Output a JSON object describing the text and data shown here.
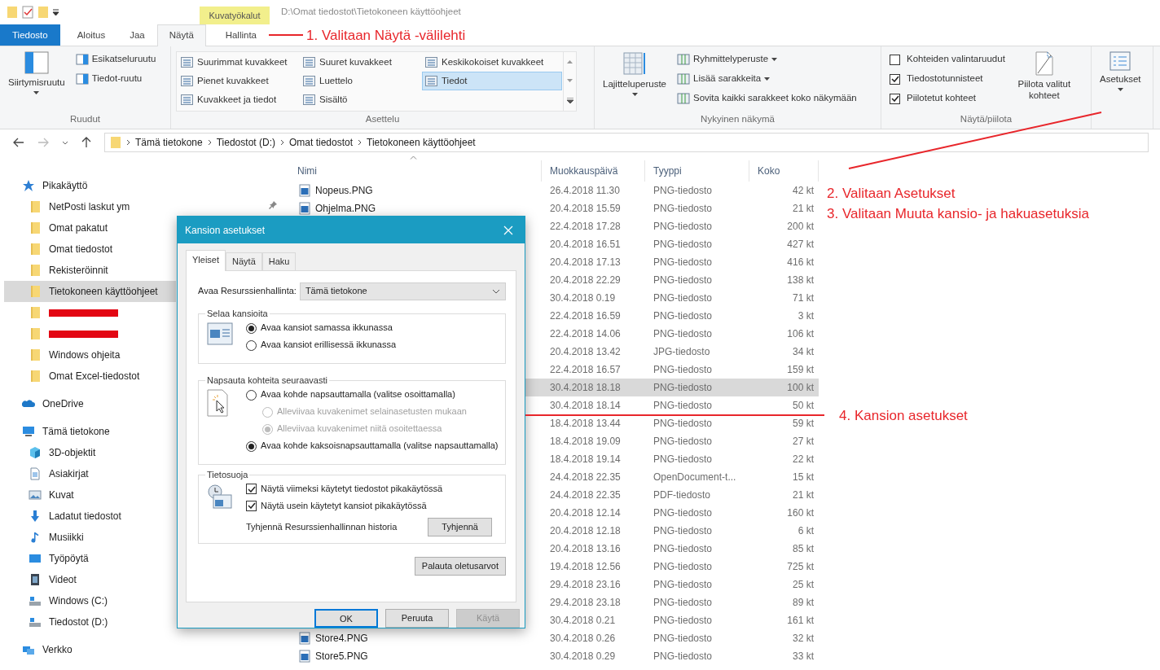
{
  "title_bar": {
    "context_tab": "Kuvatyökalut",
    "path": "D:\\Omat tiedostot\\Tietokoneen käyttöohjeet"
  },
  "ribbon_tabs": [
    {
      "label": "Tiedosto",
      "kind": "file",
      "selected": false
    },
    {
      "label": "Aloitus",
      "kind": "tab",
      "selected": false
    },
    {
      "label": "Jaa",
      "kind": "tab",
      "selected": false
    },
    {
      "label": "Näytä",
      "kind": "tab",
      "selected": true
    },
    {
      "label": "Hallinta",
      "kind": "context",
      "selected": false
    }
  ],
  "ribbon": {
    "panes": {
      "label": "Ruudut",
      "button": "Siirtymisruutu",
      "items": [
        "Esikatseluruutu",
        "Tiedot-ruutu"
      ]
    },
    "layout": {
      "label": "Asettelu",
      "options": [
        {
          "label": "Suurimmat kuvakkeet",
          "selected": false
        },
        {
          "label": "Pienet kuvakkeet",
          "selected": false
        },
        {
          "label": "Kuvakkeet ja tiedot",
          "selected": false
        },
        {
          "label": "Suuret kuvakkeet",
          "selected": false
        },
        {
          "label": "Luettelo",
          "selected": false
        },
        {
          "label": "Sisältö",
          "selected": false
        },
        {
          "label": "Keskikokoiset kuvakkeet",
          "selected": false
        },
        {
          "label": "Tiedot",
          "selected": true
        }
      ]
    },
    "current_view": {
      "label": "Nykyinen näkymä",
      "button": "Lajitteluperuste",
      "items": [
        {
          "label": "Ryhmittelyperuste",
          "dropdown": true
        },
        {
          "label": "Lisää sarakkeita",
          "dropdown": true
        },
        {
          "label": "Sovita kaikki sarakkeet koko näkymään",
          "dropdown": false
        }
      ]
    },
    "show_hide": {
      "label": "Näytä/piilota",
      "checkboxes": [
        {
          "label": "Kohteiden valintaruudut",
          "checked": false
        },
        {
          "label": "Tiedostotunnisteet",
          "checked": true
        },
        {
          "label": "Piilotetut kohteet",
          "checked": true
        }
      ],
      "button": "Piilota valitut kohteet"
    },
    "options": {
      "button": "Asetukset"
    }
  },
  "address": {
    "crumbs": [
      "Tämä tietokone",
      "Tiedostot (D:)",
      "Omat tiedostot",
      "Tietokoneen käyttöohjeet"
    ]
  },
  "navigation": [
    {
      "label": "Pikakäyttö",
      "kind": "star",
      "selected": false,
      "children": [
        {
          "label": "NetPosti laskut ym",
          "kind": "folder",
          "pinned": true,
          "selected": false
        },
        {
          "label": "Omat pakatut",
          "kind": "folder",
          "pinned": false,
          "selected": false
        },
        {
          "label": "Omat tiedostot",
          "kind": "folder",
          "pinned": false,
          "selected": false
        },
        {
          "label": "Rekisteröinnit",
          "kind": "folder",
          "pinned": false,
          "selected": false
        },
        {
          "label": "Tietokoneen käyttöohjeet",
          "kind": "folder",
          "pinned": false,
          "selected": true
        },
        {
          "kind": "redacted",
          "pinned": false,
          "selected": false
        },
        {
          "kind": "redacted",
          "pinned": false,
          "selected": false
        },
        {
          "label": "Windows ohjeita",
          "kind": "folder",
          "pinned": false,
          "selected": false
        },
        {
          "label": "Omat Excel-tiedostot",
          "kind": "folder",
          "pinned": false,
          "selected": false
        }
      ]
    },
    {
      "label": "OneDrive",
      "kind": "cloud",
      "selected": false
    },
    {
      "label": "Tämä tietokone",
      "kind": "pc",
      "selected": false,
      "children": [
        {
          "label": "3D-objektit",
          "kind": "cube",
          "selected": false
        },
        {
          "label": "Asiakirjat",
          "kind": "document",
          "selected": false
        },
        {
          "label": "Kuvat",
          "kind": "pictures",
          "selected": false
        },
        {
          "label": "Ladatut tiedostot",
          "kind": "download",
          "selected": false
        },
        {
          "label": "Musiikki",
          "kind": "music",
          "selected": false
        },
        {
          "label": "Työpöytä",
          "kind": "desktop",
          "selected": false
        },
        {
          "label": "Videot",
          "kind": "video",
          "selected": false
        },
        {
          "label": "Windows (C:)",
          "kind": "drive",
          "selected": false
        },
        {
          "label": "Tiedostot (D:)",
          "kind": "drive",
          "selected": false
        }
      ]
    },
    {
      "label": "Verkko",
      "kind": "network",
      "selected": false
    }
  ],
  "file_list": {
    "columns": [
      {
        "label": "Nimi",
        "sorted": true
      },
      {
        "label": "Muokkauspäivä",
        "sorted": false
      },
      {
        "label": "Tyyppi",
        "sorted": false
      },
      {
        "label": "Koko",
        "sorted": false
      }
    ],
    "rows": [
      {
        "name": "Nopeus.PNG",
        "modified": "26.4.2018 11.30",
        "type": "PNG-tiedosto",
        "size": "42 kt",
        "selected": false
      },
      {
        "name": "Ohjelma.PNG",
        "modified": "20.4.2018 15.59",
        "type": "PNG-tiedosto",
        "size": "21 kt",
        "selected": false
      },
      {
        "modified": "22.4.2018 17.28",
        "type": "PNG-tiedosto",
        "size": "200 kt",
        "selected": false
      },
      {
        "modified": "20.4.2018 16.51",
        "type": "PNG-tiedosto",
        "size": "427 kt",
        "selected": false
      },
      {
        "modified": "20.4.2018 17.13",
        "type": "PNG-tiedosto",
        "size": "416 kt",
        "selected": false
      },
      {
        "modified": "20.4.2018 22.29",
        "type": "PNG-tiedosto",
        "size": "138 kt",
        "selected": false
      },
      {
        "modified": "30.4.2018 0.19",
        "type": "PNG-tiedosto",
        "size": "71 kt",
        "selected": false
      },
      {
        "modified": "22.4.2018 16.59",
        "type": "PNG-tiedosto",
        "size": "3 kt",
        "selected": false
      },
      {
        "modified": "22.4.2018 14.06",
        "type": "PNG-tiedosto",
        "size": "106 kt",
        "selected": false
      },
      {
        "modified": "20.4.2018 13.42",
        "type": "JPG-tiedosto",
        "size": "34 kt",
        "selected": false
      },
      {
        "modified": "22.4.2018 16.57",
        "type": "PNG-tiedosto",
        "size": "159 kt",
        "selected": false
      },
      {
        "modified": "30.4.2018 18.18",
        "type": "PNG-tiedosto",
        "size": "100 kt",
        "selected": true
      },
      {
        "modified": "30.4.2018 18.14",
        "type": "PNG-tiedosto",
        "size": "50 kt",
        "selected": false
      },
      {
        "modified": "18.4.2018 13.44",
        "type": "PNG-tiedosto",
        "size": "59 kt",
        "selected": false
      },
      {
        "modified": "18.4.2018 19.09",
        "type": "PNG-tiedosto",
        "size": "27 kt",
        "selected": false
      },
      {
        "modified": "18.4.2018 19.14",
        "type": "PNG-tiedosto",
        "size": "22 kt",
        "selected": false
      },
      {
        "modified": "24.4.2018 22.35",
        "type": "OpenDocument-t...",
        "size": "15 kt",
        "selected": false
      },
      {
        "modified": "24.4.2018 22.35",
        "type": "PDF-tiedosto",
        "size": "21 kt",
        "selected": false
      },
      {
        "modified": "20.4.2018 12.14",
        "type": "PNG-tiedosto",
        "size": "160 kt",
        "selected": false
      },
      {
        "modified": "20.4.2018 12.18",
        "type": "PNG-tiedosto",
        "size": "6 kt",
        "selected": false
      },
      {
        "modified": "20.4.2018 13.16",
        "type": "PNG-tiedosto",
        "size": "85 kt",
        "selected": false
      },
      {
        "modified": "19.4.2018 12.56",
        "type": "PNG-tiedosto",
        "size": "725 kt",
        "selected": false
      },
      {
        "modified": "29.4.2018 23.16",
        "type": "PNG-tiedosto",
        "size": "25 kt",
        "selected": false
      },
      {
        "modified": "29.4.2018 23.18",
        "type": "PNG-tiedosto",
        "size": "89 kt",
        "selected": false
      },
      {
        "modified": "30.4.2018 0.21",
        "type": "PNG-tiedosto",
        "size": "161 kt",
        "selected": false
      },
      {
        "name": "Store4.PNG",
        "modified": "30.4.2018 0.26",
        "type": "PNG-tiedosto",
        "size": "32 kt",
        "selected": false
      },
      {
        "name": "Store5.PNG",
        "modified": "30.4.2018 0.29",
        "type": "PNG-tiedosto",
        "size": "33 kt",
        "selected": false
      }
    ]
  },
  "dialog": {
    "title": "Kansion asetukset",
    "tabs": [
      {
        "label": "Yleiset",
        "selected": true
      },
      {
        "label": "Näytä",
        "selected": false
      },
      {
        "label": "Haku",
        "selected": false
      }
    ],
    "open_in": {
      "label": "Avaa Resurssienhallinta:",
      "value": "Tämä tietokone"
    },
    "browse_folders": {
      "legend": "Selaa kansioita",
      "options": [
        {
          "label": "Avaa kansiot samassa ikkunassa",
          "selected": true,
          "disabled": false
        },
        {
          "label": "Avaa kansiot erillisessä ikkunassa",
          "selected": false,
          "disabled": false
        }
      ]
    },
    "click_items": {
      "legend": "Napsauta kohteita seuraavasti",
      "options": [
        {
          "label": "Avaa kohde napsauttamalla (valitse osoittamalla)",
          "selected": false,
          "disabled": false,
          "children": [
            {
              "label": "Alleviivaa kuvakenimet selainasetusten mukaan",
              "selected": false,
              "disabled": true
            },
            {
              "label": "Alleviivaa kuvakenimet niitä osoitettaessa",
              "selected": true,
              "disabled": true
            }
          ]
        },
        {
          "label": "Avaa kohde kaksoisnapsauttamalla (valitse napsauttamalla)",
          "selected": true,
          "disabled": false
        }
      ]
    },
    "privacy": {
      "legend": "Tietosuoja",
      "checkboxes": [
        {
          "label": "Näytä viimeksi käytetyt tiedostot pikakäytössä",
          "checked": true
        },
        {
          "label": "Näytä usein käytetyt kansiot pikakäytössä",
          "checked": true
        }
      ],
      "clear_label": "Tyhjennä Resurssienhallinnan historia",
      "clear_button": "Tyhjennä"
    },
    "restore_button": "Palauta oletusarvot",
    "buttons": [
      {
        "label": "OK",
        "default": true,
        "disabled": false
      },
      {
        "label": "Peruuta",
        "default": false,
        "disabled": false
      },
      {
        "label": "Käytä",
        "default": false,
        "disabled": true
      }
    ]
  },
  "annotations": [
    {
      "text": "1. Valitaan Näytä -välilehti"
    },
    {
      "text": "2. Valitaan Asetukset"
    },
    {
      "text": "3. Valitaan Muuta kansio- ja hakuasetuksia"
    },
    {
      "text": "4. Kansion asetukset"
    }
  ]
}
